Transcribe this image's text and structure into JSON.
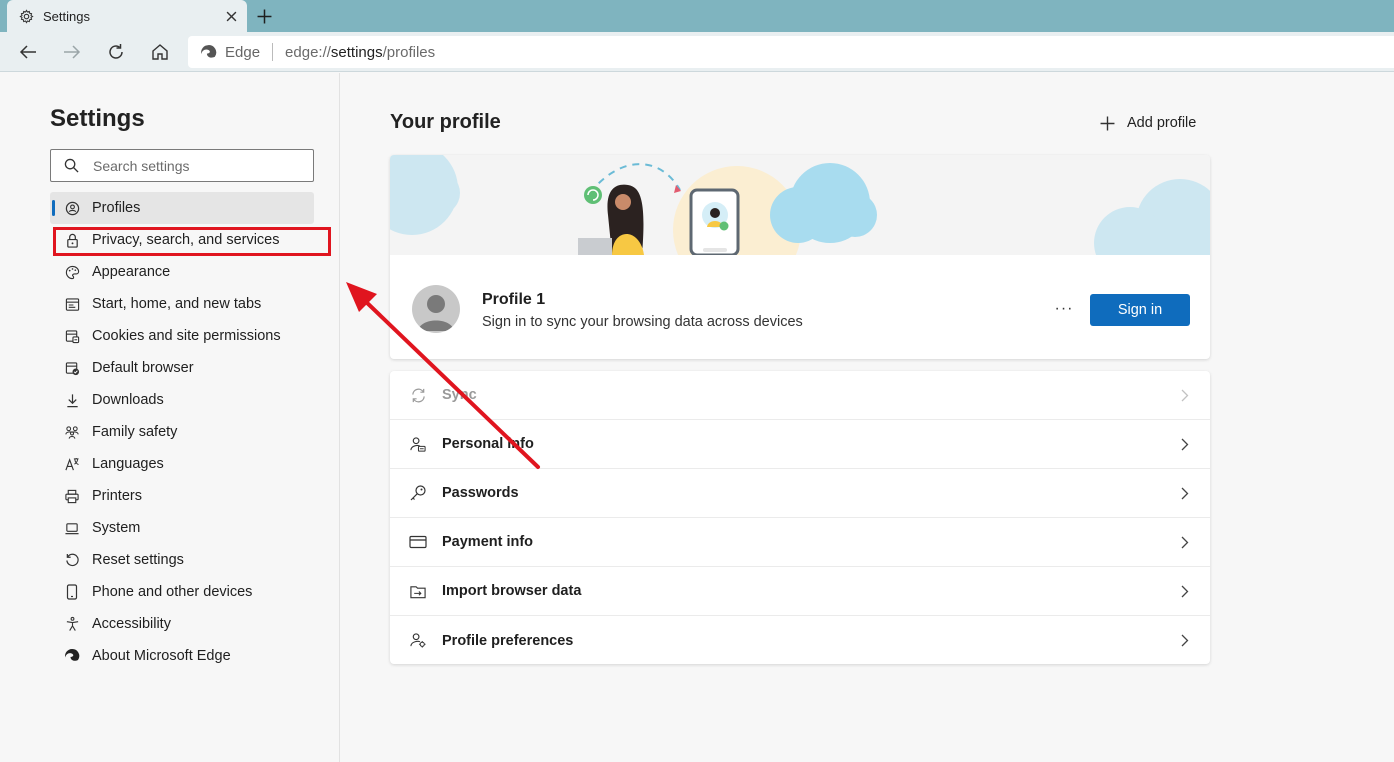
{
  "tab": {
    "title": "Settings",
    "icon": "gear-icon"
  },
  "toolbar": {
    "brand": "Edge",
    "url_prefix": "edge://",
    "url_bold": "settings",
    "url_suffix": "/profiles"
  },
  "sidebar": {
    "title": "Settings",
    "search_placeholder": "Search settings",
    "items": [
      {
        "label": "Profiles",
        "icon": "profile-icon",
        "active": true
      },
      {
        "label": "Privacy, search, and services",
        "icon": "lock-icon"
      },
      {
        "label": "Appearance",
        "icon": "palette-icon"
      },
      {
        "label": "Start, home, and new tabs",
        "icon": "home-tabs-icon"
      },
      {
        "label": "Cookies and site permissions",
        "icon": "cookies-icon"
      },
      {
        "label": "Default browser",
        "icon": "default-browser-icon"
      },
      {
        "label": "Downloads",
        "icon": "download-icon"
      },
      {
        "label": "Family safety",
        "icon": "family-icon"
      },
      {
        "label": "Languages",
        "icon": "languages-icon"
      },
      {
        "label": "Printers",
        "icon": "printer-icon"
      },
      {
        "label": "System",
        "icon": "laptop-icon"
      },
      {
        "label": "Reset settings",
        "icon": "reset-icon"
      },
      {
        "label": "Phone and other devices",
        "icon": "phone-icon"
      },
      {
        "label": "Accessibility",
        "icon": "accessibility-icon"
      },
      {
        "label": "About Microsoft Edge",
        "icon": "edge-logo-icon"
      }
    ]
  },
  "main": {
    "title": "Your profile",
    "add_profile": "Add profile",
    "profile": {
      "name": "Profile 1",
      "description": "Sign in to sync your browsing data across devices",
      "more": "···",
      "sign_in": "Sign in"
    },
    "rows": [
      {
        "label": "Sync",
        "icon": "sync-icon",
        "disabled": true
      },
      {
        "label": "Personal info",
        "icon": "personal-info-icon"
      },
      {
        "label": "Passwords",
        "icon": "key-icon"
      },
      {
        "label": "Payment info",
        "icon": "credit-card-icon"
      },
      {
        "label": "Import browser data",
        "icon": "import-icon"
      },
      {
        "label": "Profile preferences",
        "icon": "profile-preferences-icon"
      }
    ]
  },
  "colors": {
    "accent": "#0f6cbd",
    "annotation_red": "#e0151f",
    "tabstrip": "#7fb4bf"
  }
}
